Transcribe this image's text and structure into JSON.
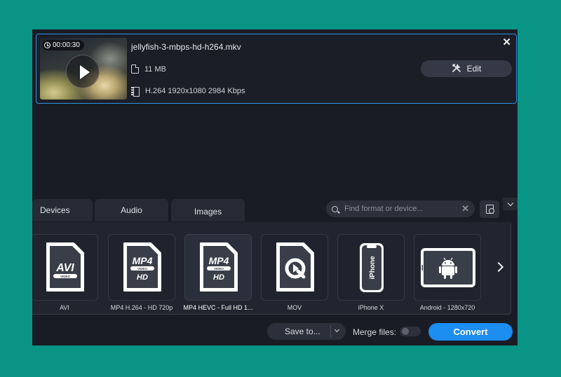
{
  "file": {
    "duration": "00:00:30",
    "name": "jellyfish-3-mbps-hd-h264.mkv",
    "size": "11 MB",
    "codec": "H.264 1920x1080 2984 Kbps",
    "edit_label": "Edit",
    "close_glyph": "✕"
  },
  "tabs": [
    {
      "label": "Devices"
    },
    {
      "label": "Audio"
    },
    {
      "label": "Images"
    }
  ],
  "search": {
    "placeholder": "Find format or device...",
    "clear_glyph": "✕"
  },
  "presets": [
    {
      "label": "AVI",
      "icon": "avi-file-icon",
      "big": "AVI",
      "band": "VIDEO"
    },
    {
      "label": "MP4 H.264 - HD 720p",
      "icon": "mp4-hd-file-icon",
      "big": "MP4",
      "band": "VIDEO",
      "sub": "HD"
    },
    {
      "label": "MP4 HEVC - Full HD 1...",
      "icon": "mp4-hd-file-icon",
      "big": "MP4",
      "band": "VIDEO",
      "sub": "HD",
      "selected": true
    },
    {
      "label": "MOV",
      "icon": "quicktime-file-icon"
    },
    {
      "label": "iPhone X",
      "icon": "iphone-icon",
      "device_text": "iPhone"
    },
    {
      "label": "Android - 1280x720",
      "icon": "android-tablet-icon"
    }
  ],
  "bottom": {
    "save_label": "Save to...",
    "merge_label": "Merge files:",
    "merge_on": false,
    "convert_label": "Convert"
  },
  "colors": {
    "background": "#0a9486",
    "window": "#191c24",
    "accent": "#1c8df1",
    "selection_border": "#2f8fe0"
  }
}
